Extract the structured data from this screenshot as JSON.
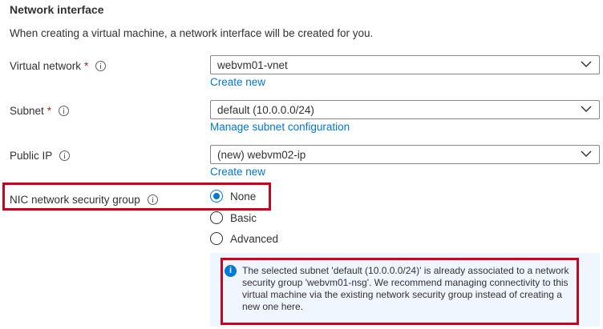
{
  "section": {
    "title": "Network interface",
    "description": "When creating a virtual machine, a network interface will be created for you."
  },
  "virtual_network": {
    "label": "Virtual network",
    "required_mark": "*",
    "value": "webvm01-vnet",
    "link": "Create new"
  },
  "subnet": {
    "label": "Subnet",
    "required_mark": "*",
    "value": "default (10.0.0.0/24)",
    "link": "Manage subnet configuration"
  },
  "public_ip": {
    "label": "Public IP",
    "value": "(new) webvm02-ip",
    "link": "Create new"
  },
  "nic_nsg": {
    "label": "NIC network security group",
    "options": [
      "None",
      "Basic",
      "Advanced"
    ],
    "selected": "None"
  },
  "info_banner": {
    "text": "The selected subnet 'default (10.0.0.0/24)' is already associated to a network security group 'webvm01-nsg'. We recommend managing connectivity to this virtual machine via the existing network security group instead of creating a new one here."
  },
  "colors": {
    "accent": "#0078d4",
    "highlight": "#d0021b",
    "required": "#a4262c",
    "banner_bg": "#f0f6ff"
  }
}
